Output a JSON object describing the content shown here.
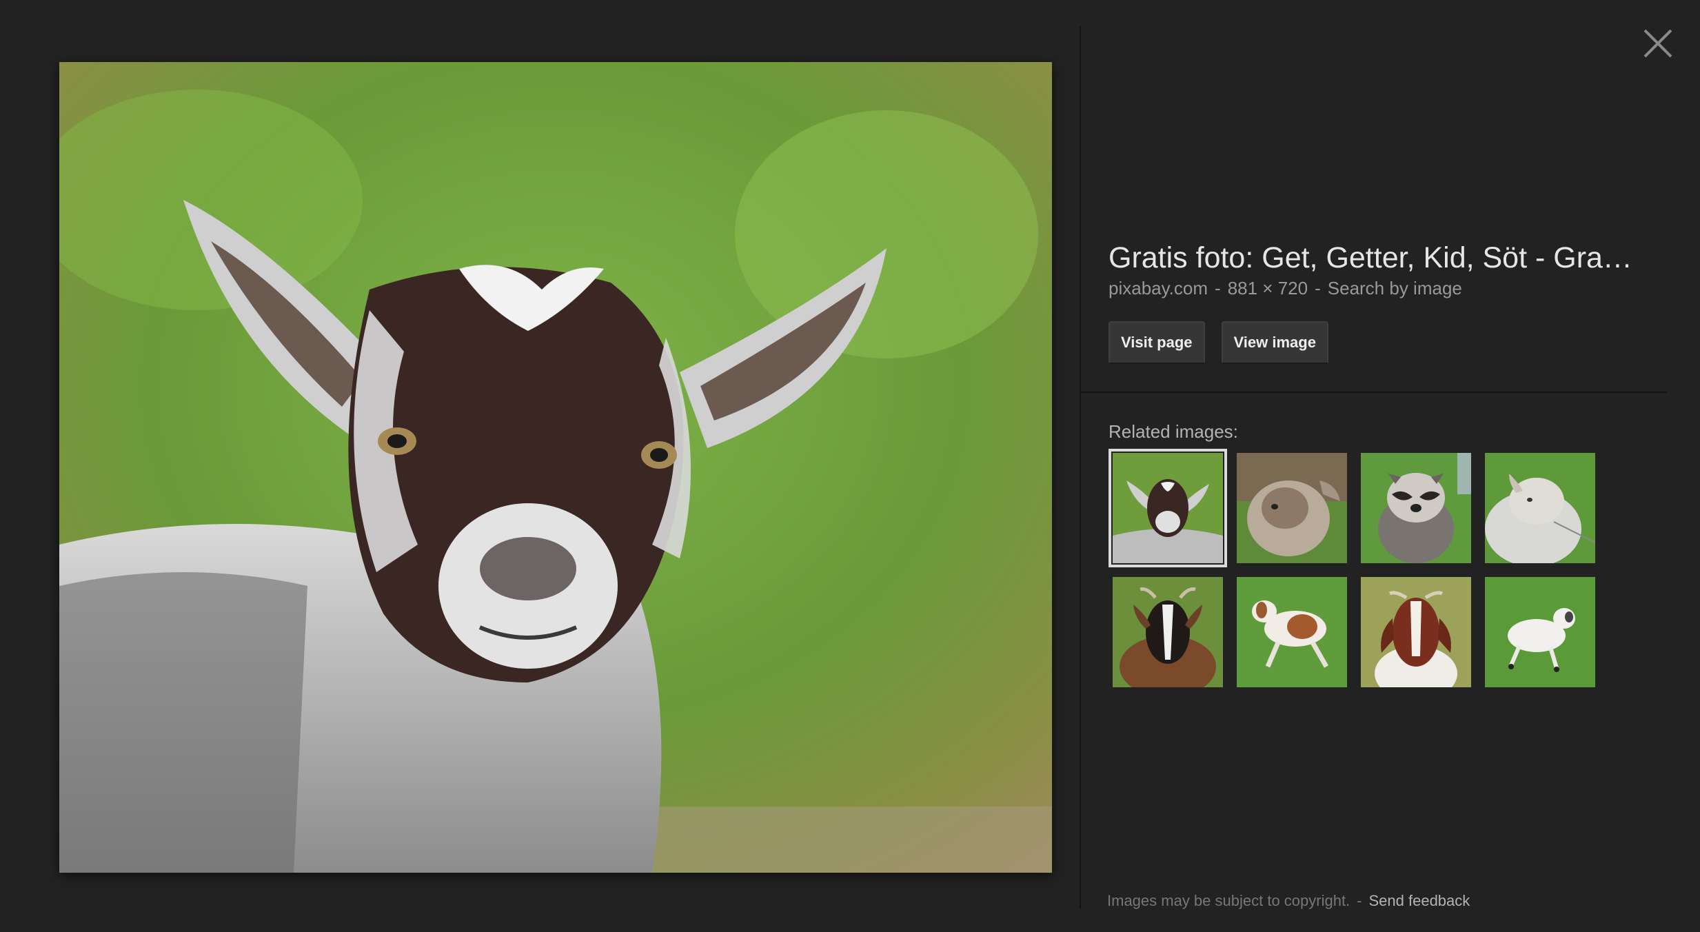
{
  "viewer": {
    "close_icon": "close-icon",
    "main_image_alt": "goat kid portrait"
  },
  "info": {
    "title": "Gratis foto: Get, Getter, Kid, Söt - Gra…",
    "source": "pixabay.com",
    "dimensions": "881 × 720",
    "separator": "-",
    "search_by_image": "Search by image",
    "visit_page_label": "Visit page",
    "view_image_label": "View image"
  },
  "related": {
    "label": "Related images:",
    "items": [
      {
        "subject": "goat kid",
        "selected": true
      },
      {
        "subject": "goat kid in grass"
      },
      {
        "subject": "raccoon"
      },
      {
        "subject": "white goat"
      },
      {
        "subject": "brown goat"
      },
      {
        "subject": "jumping goat kid"
      },
      {
        "subject": "boer goat"
      },
      {
        "subject": "white goat kid running"
      }
    ]
  },
  "footer": {
    "copyright": "Images may be subject to copyright.",
    "separator": "-",
    "feedback_label": "Send feedback"
  },
  "colors": {
    "background": "#222222",
    "title": "#e6e6e6",
    "meta": "#999999",
    "button_bg": "#363636"
  }
}
